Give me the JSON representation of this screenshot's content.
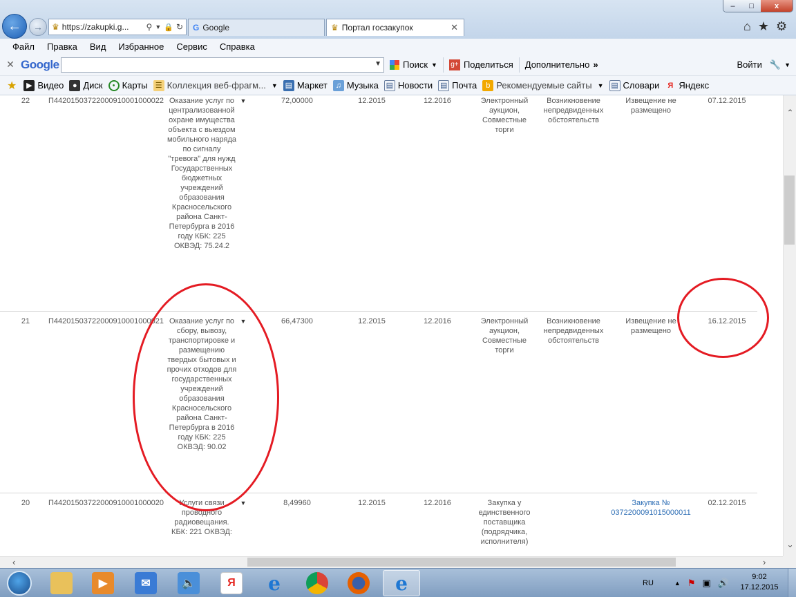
{
  "browser": {
    "address": "https://zakupki.g...",
    "tabs": [
      {
        "label": "Google"
      },
      {
        "label": "Портал госзакупок"
      }
    ],
    "window_controls": {
      "minimize": "–",
      "maximize": "□",
      "close": "x"
    }
  },
  "menu": [
    "Файл",
    "Правка",
    "Вид",
    "Избранное",
    "Сервис",
    "Справка"
  ],
  "google_toolbar": {
    "logo": "Google",
    "search_value": "",
    "search_label": "Поиск",
    "share_label": "Поделиться",
    "more_label": "Дополнительно",
    "login_label": "Войти"
  },
  "favorites": [
    {
      "label": "Видео"
    },
    {
      "label": "Диск"
    },
    {
      "label": "Карты"
    },
    {
      "label": "Коллекция веб-фрагм..."
    },
    {
      "label": "Маркет"
    },
    {
      "label": "Музыка"
    },
    {
      "label": "Новости"
    },
    {
      "label": "Почта"
    },
    {
      "label": "Рекомендуемые сайты"
    },
    {
      "label": "Словари"
    },
    {
      "label": "Яндекс"
    }
  ],
  "rows": [
    {
      "num": "22",
      "id": "П44201503722000910001000022",
      "desc": "Оказание услуг по централизованной охране имущества объекта с выездом мобильного наряда по сигналу \"тревога\" для нужд Государственных бюджетных учреждений образования Красносельского района Санкт-Петербурга в 2016 году КБК: 225 ОКВЭД: 75.24.2",
      "sum": "72,00000",
      "month1": "12.2015",
      "month2": "12.2016",
      "method": "Электронный аукцион, Совместные торги",
      "reason": "Возникновение непредвиденных обстоятельств",
      "notice": "Извещение не размещено",
      "date": "07.12.2015"
    },
    {
      "num": "21",
      "id": "П44201503722000910001000021",
      "desc": "Оказание услуг по сбору, вывозу, транспортировке и размещению твердых бытовых и прочих отходов для государственных учреждений образования Красносельского района Санкт-Петербурга в 2016 году КБК: 225 ОКВЭД: 90.02",
      "sum": "66,47300",
      "month1": "12.2015",
      "month2": "12.2016",
      "method": "Электронный аукцион, Совместные торги",
      "reason": "Возникновение непредвиденных обстоятельств",
      "notice": "Извещение не размещено",
      "date": "16.12.2015"
    },
    {
      "num": "20",
      "id": "П44201503722000910001000020",
      "desc": "Услуги связи проводного радиовещания. КБК: 221 ОКВЭД:",
      "sum": "8,49960",
      "month1": "12.2015",
      "month2": "12.2016",
      "method": "Закупка у единственного поставщика (подрядчика, исполнителя)",
      "reason": "",
      "notice": "Закупка № 0372200091015000011",
      "date": "02.12.2015"
    }
  ],
  "taskbar": {
    "lang": "RU",
    "time": "9:02",
    "date": "17.12.2015"
  },
  "colors": {
    "annotation": "#e41b23",
    "link": "#2b6cb4"
  }
}
